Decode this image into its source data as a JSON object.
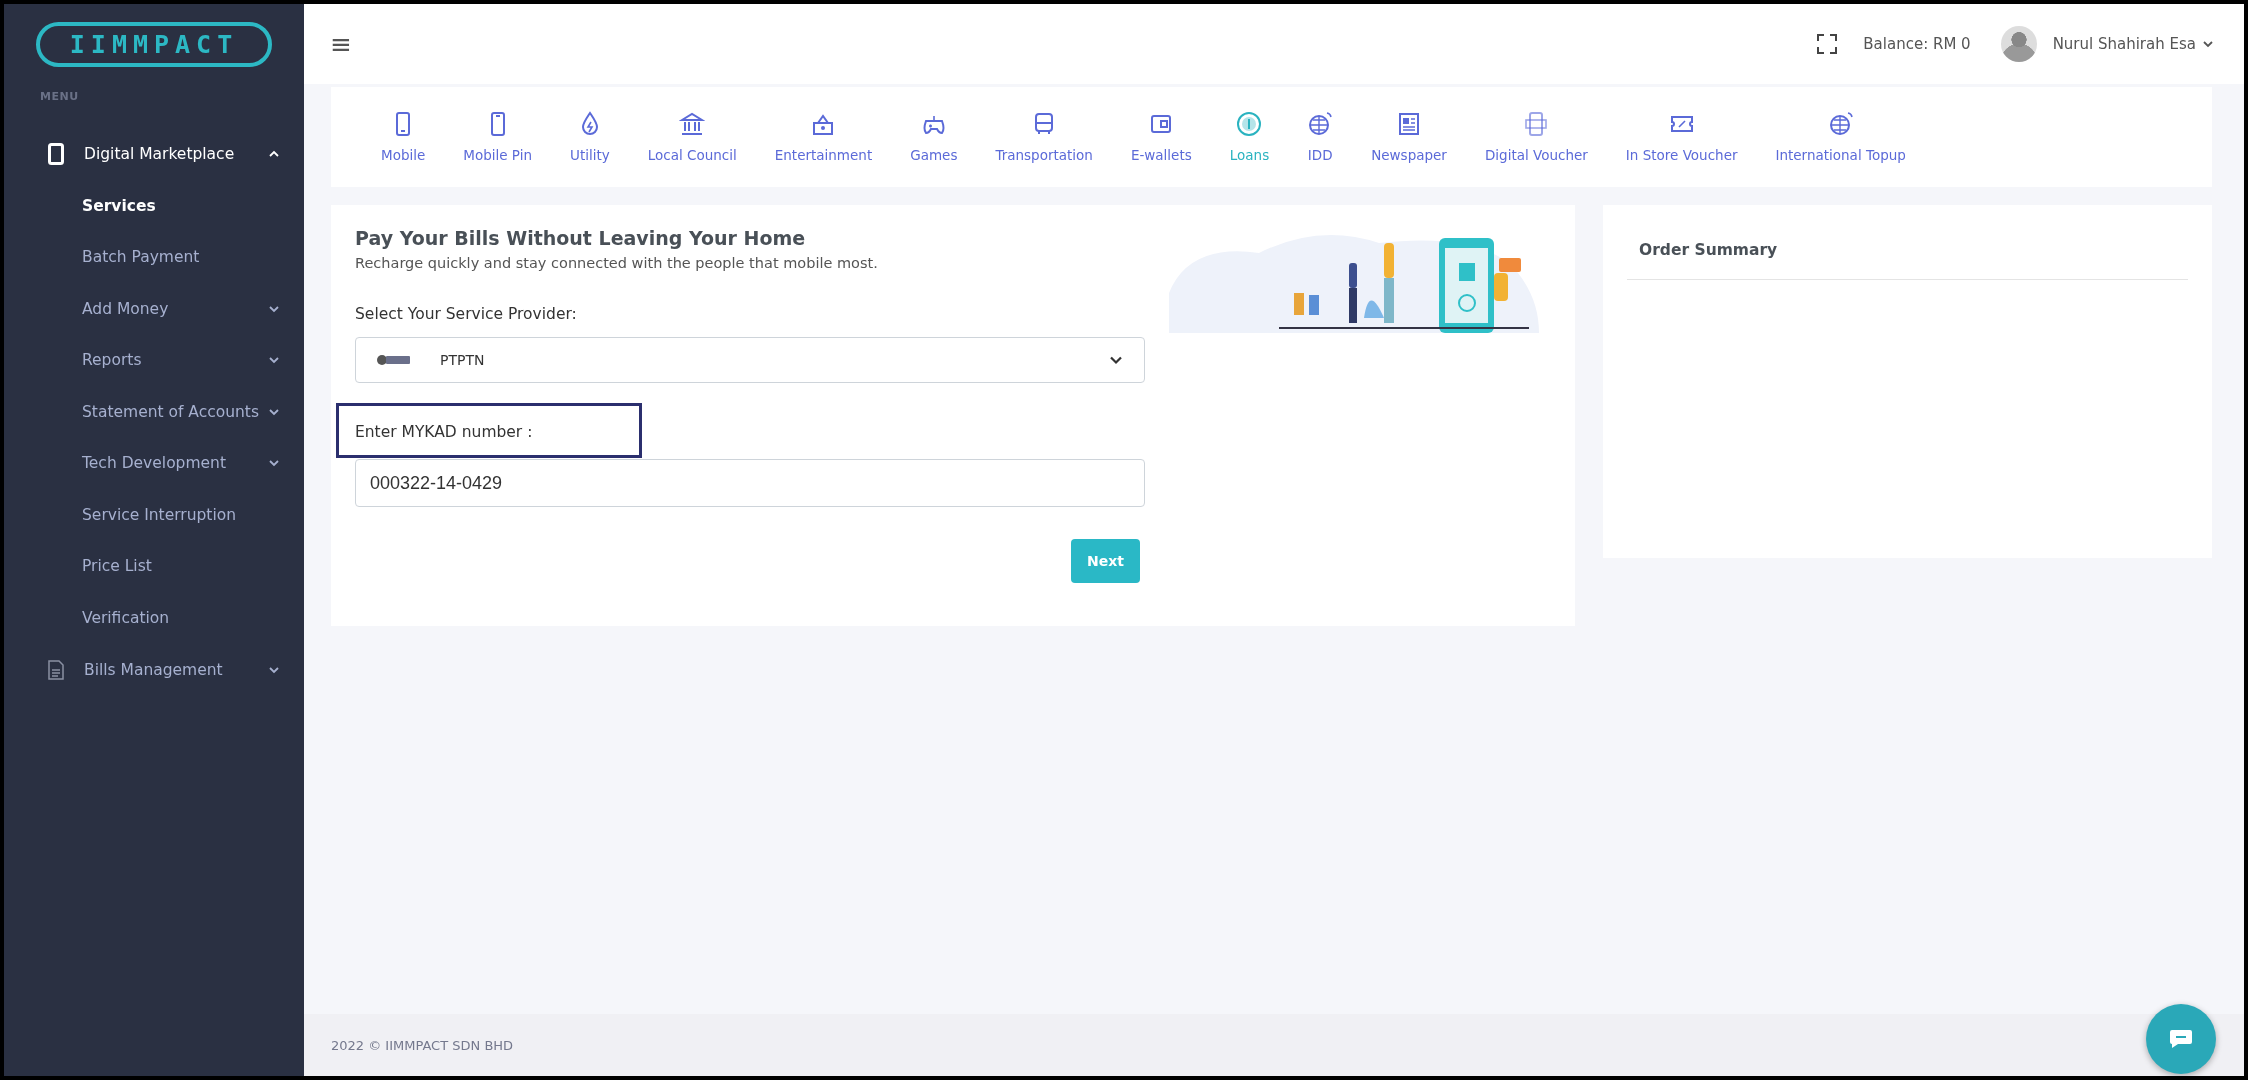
{
  "sidebar": {
    "logo": "IIMMPACT",
    "menu_label": "MENU",
    "items": [
      {
        "label": "Digital Marketplace",
        "expanded": true,
        "children": [
          {
            "label": "Services",
            "kind": "link",
            "selected": true
          },
          {
            "label": "Batch Payment",
            "kind": "link",
            "selected": false
          },
          {
            "label": "Add Money",
            "kind": "submenu",
            "selected": false,
            "expanded": false
          },
          {
            "label": "Reports",
            "kind": "submenu",
            "selected": false,
            "expanded": false
          },
          {
            "label": "Statement of Accounts",
            "kind": "submenu",
            "selected": false,
            "expanded": false
          },
          {
            "label": "Tech Development",
            "kind": "submenu",
            "selected": false,
            "expanded": false
          },
          {
            "label": "Service Interruption",
            "kind": "link",
            "selected": false
          },
          {
            "label": "Price List",
            "kind": "link",
            "selected": false
          },
          {
            "label": "Verification",
            "kind": "link",
            "selected": false
          }
        ]
      },
      {
        "label": "Bills Management",
        "expanded": false
      }
    ]
  },
  "topbar": {
    "menu_glyph": "≡",
    "balance": "Balance: RM 0",
    "user_name": "Nurul Shahirah Esa"
  },
  "service_tabs": [
    {
      "label": "Mobile",
      "selected": false
    },
    {
      "label": "Mobile Pin",
      "selected": false
    },
    {
      "label": "Utility",
      "selected": false
    },
    {
      "label": "Local Council",
      "selected": false
    },
    {
      "label": "Entertainment",
      "selected": false
    },
    {
      "label": "Games",
      "selected": false
    },
    {
      "label": "Transportation",
      "selected": false
    },
    {
      "label": "E-wallets",
      "selected": false
    },
    {
      "label": "Loans",
      "selected": true
    },
    {
      "label": "IDD",
      "selected": false
    },
    {
      "label": "Newspaper",
      "selected": false
    },
    {
      "label": "Digital Voucher",
      "selected": false
    },
    {
      "label": "In Store Voucher",
      "selected": false
    },
    {
      "label": "International Topup",
      "selected": false
    }
  ],
  "form": {
    "title": "Pay Your Bills Without Leaving Your Home",
    "subtitle": "Recharge quickly and stay connected with the people that mobile most.",
    "provider_label": "Select Your Service Provider:",
    "provider": "PTPTN",
    "mykad_label": "Enter MYKAD number :",
    "mykad_highlighted": true,
    "mykad_value": "000322-14-0429",
    "next_button": "Next"
  },
  "order_summary": {
    "title": "Order Summary"
  },
  "footer": {
    "text": "2022 © IIMMPACT SDN BHD"
  }
}
